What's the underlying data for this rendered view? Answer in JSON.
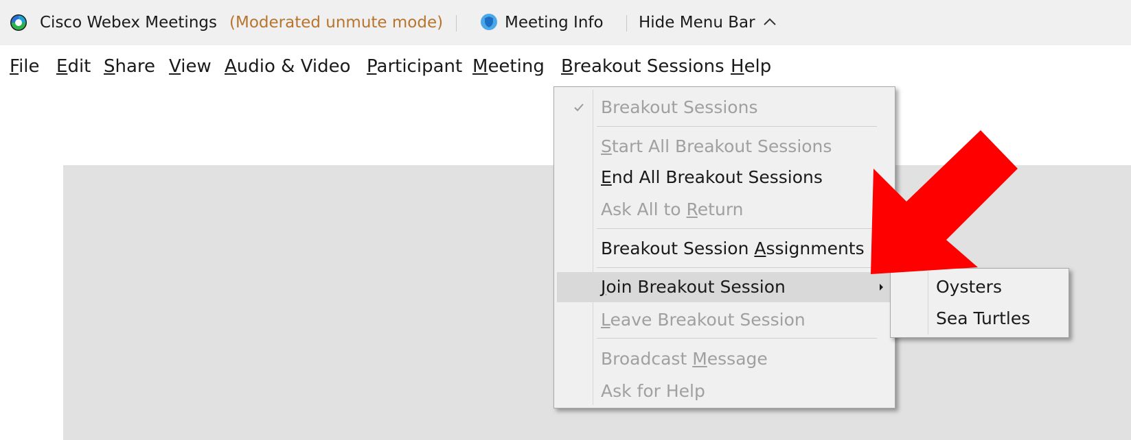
{
  "titlebar": {
    "app_title": "Cisco Webex Meetings",
    "mode": "(Moderated unmute mode)",
    "meeting_info": "Meeting Info",
    "hide_menu": "Hide Menu Bar",
    "logo_icon": "webex-logo-icon",
    "info_icon": "shield-info-icon",
    "chevron_icon": "chevron-up-icon",
    "mode_color": "#b8742d"
  },
  "menubar": {
    "items": [
      {
        "first": "F",
        "rest": "ile"
      },
      {
        "first": "E",
        "rest": "dit"
      },
      {
        "first": "S",
        "rest": "hare"
      },
      {
        "first": "V",
        "rest": "iew"
      },
      {
        "first": "A",
        "rest": "udio & Video"
      },
      {
        "first": "P",
        "rest": "articipant"
      },
      {
        "first": "M",
        "rest": "eeting"
      },
      {
        "first": "B",
        "rest": "reakout Sessions"
      },
      {
        "first": "H",
        "rest": "elp"
      }
    ]
  },
  "dropdown": {
    "breakout_sessions": "Breakout Sessions",
    "start_all": {
      "first": "S",
      "rest": "tart All Breakout Sessions"
    },
    "end_all": {
      "first": "E",
      "rest": "nd All Breakout Sessions"
    },
    "ask_return": {
      "pre": "Ask All to ",
      "u": "R",
      "post": "eturn"
    },
    "assignments": {
      "pre": "Breakout Session ",
      "u": "A",
      "post": "ssignments"
    },
    "join": {
      "first": "J",
      "rest": "oin Breakout Session"
    },
    "leave": {
      "first": "L",
      "rest": "eave Breakout Session"
    },
    "broadcast": {
      "pre": "Broadcast ",
      "u": "M",
      "post": "essage"
    },
    "ask_help": "Ask for Help"
  },
  "submenu": {
    "items": [
      "Oysters",
      "Sea Turtles"
    ]
  },
  "colors": {
    "titlebar_bg": "#f0f0f0",
    "content_bg": "#e1e1e1",
    "menu_bg": "#f0f0f0",
    "disabled_text": "#a0a0a0",
    "arrow_red": "#ff0000"
  }
}
